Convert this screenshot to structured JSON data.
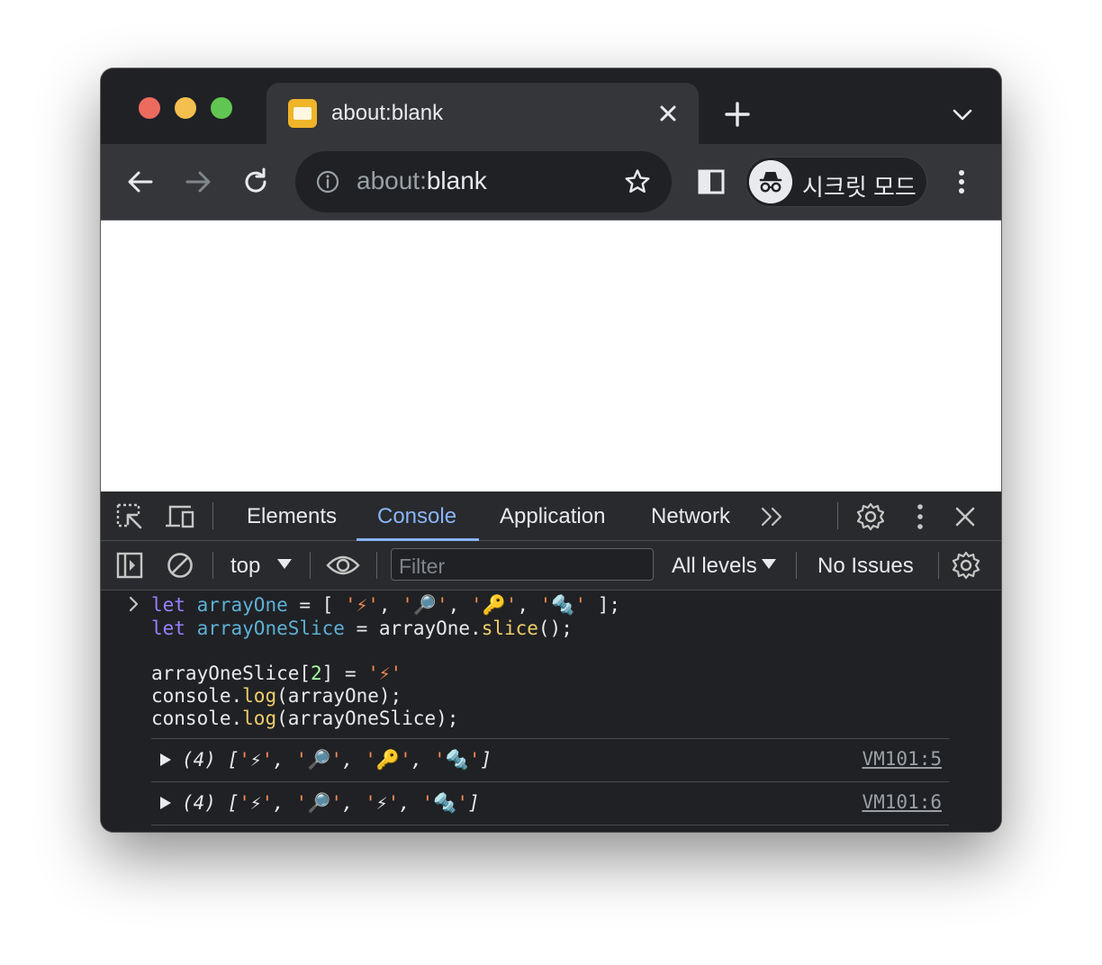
{
  "tab": {
    "title": "about:blank"
  },
  "omnibox": {
    "scheme": "about:",
    "host": "blank"
  },
  "profile": {
    "label": "시크릿 모드"
  },
  "devtools": {
    "tabs": [
      "Elements",
      "Console",
      "Application",
      "Network"
    ],
    "active_tab": "Console"
  },
  "console_bar": {
    "context": "top",
    "filter_placeholder": "Filter",
    "levels": "All levels",
    "issues": "No Issues"
  },
  "code": {
    "l1": {
      "kw": "let",
      "var": "arrayOne",
      "eq": " = [ ",
      "s1": "'⚡'",
      "c1": ", ",
      "s2": "'🔎'",
      "c2": ", ",
      "s3": "'🔑'",
      "c3": ", ",
      "s4": "'🔩'",
      "end": " ];"
    },
    "l2": {
      "kw": "let",
      "var": "arrayOneSlice",
      "eq": " = arrayOne.",
      "fn": "slice",
      "end": "();"
    },
    "l3": {
      "pre": "arrayOneSlice[",
      "num": "2",
      "mid": "] = ",
      "str": "'⚡'"
    },
    "l4": {
      "pre": "console.",
      "fn": "log",
      "end": "(arrayOne);"
    },
    "l5": {
      "pre": "console.",
      "fn": "log",
      "end": "(arrayOneSlice);"
    }
  },
  "outputs": [
    {
      "count": "(4) ",
      "items": [
        "⚡",
        "🔎",
        "🔑",
        "🔩"
      ],
      "source": "VM101:5"
    },
    {
      "count": "(4) ",
      "items": [
        "⚡",
        "🔎",
        "⚡",
        "🔩"
      ],
      "source": "VM101:6"
    }
  ]
}
